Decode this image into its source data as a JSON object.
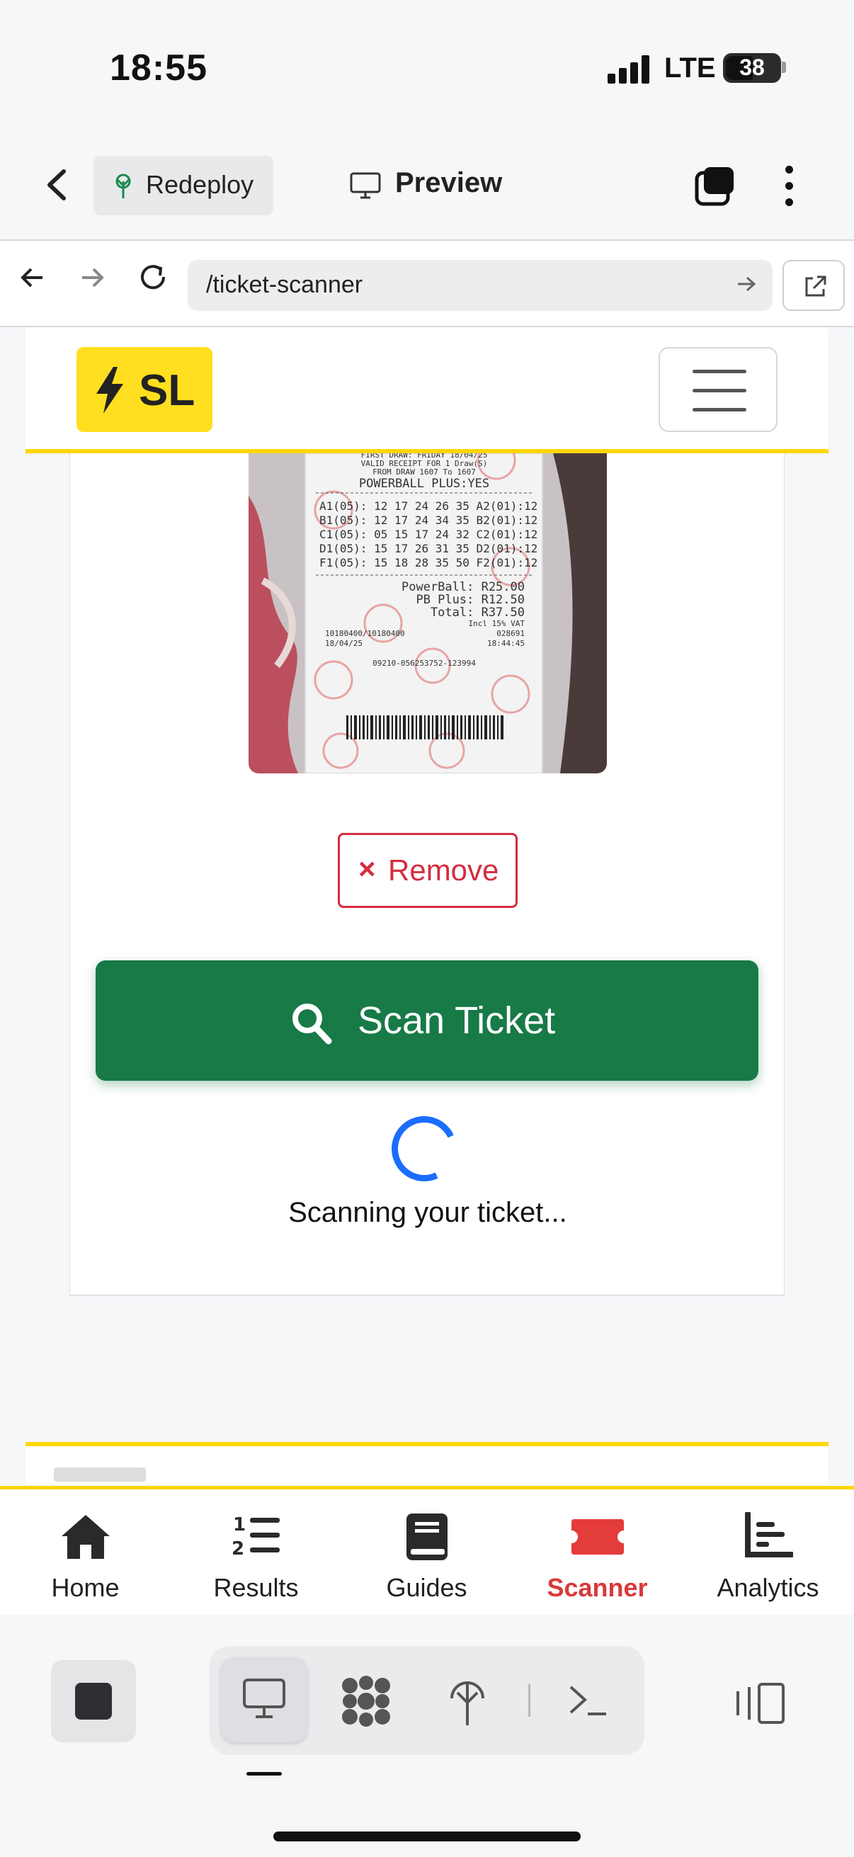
{
  "status_bar": {
    "time": "18:55",
    "network": "LTE",
    "battery": "38"
  },
  "app_toolbar": {
    "redeploy_label": "Redeploy",
    "preview_label": "Preview"
  },
  "browser": {
    "url": "/ticket-scanner"
  },
  "site": {
    "logo_text": "SL"
  },
  "ticket": {
    "header_lines": [
      "FIRST DRAW: FRIDAY 18/04/25",
      "VALID RECEIPT FOR 1 Draw(S)",
      "FROM DRAW 1607 To 1607"
    ],
    "powerball_plus": "POWERBALL PLUS:YES",
    "boards": [
      "A1(05): 12 17 24 26 35 A2(01):12",
      "B1(05): 12 17 24 34 35 B2(01):12",
      "C1(05): 05 15 17 24 32 C2(01):12",
      "D1(05): 15 17 26 31 35 D2(01):12",
      "F1(05): 15 18 28 35 50 F2(01):12"
    ],
    "powerball_line": "PowerBall:  R25.00",
    "pb_plus_line": "PB Plus:  R12.50",
    "total_line": "Total:  R37.50",
    "vat_line": "Incl 15% VAT",
    "terminal": "10180400/10180400",
    "code": "028691",
    "date": "18/04/25",
    "time": "18:44:45",
    "serial": "09210-056253752-123994"
  },
  "actions": {
    "remove_icon": "×",
    "remove_label": "Remove",
    "scan_label": "Scan Ticket",
    "scanning_text": "Scanning your ticket..."
  },
  "bottom_nav": {
    "items": [
      {
        "label": "Home",
        "icon": "home-icon",
        "active": false
      },
      {
        "label": "Results",
        "icon": "list-ordered-icon",
        "active": false
      },
      {
        "label": "Guides",
        "icon": "book-icon",
        "active": false
      },
      {
        "label": "Scanner",
        "icon": "ticket-icon",
        "active": true
      },
      {
        "label": "Analytics",
        "icon": "chart-icon",
        "active": false
      }
    ]
  },
  "colors": {
    "accent_yellow": "#ffd60a",
    "scan_green": "#177a47",
    "remove_red": "#d42d3f",
    "active_nav_red": "#d93a3a",
    "spinner_blue": "#1a6dff"
  }
}
